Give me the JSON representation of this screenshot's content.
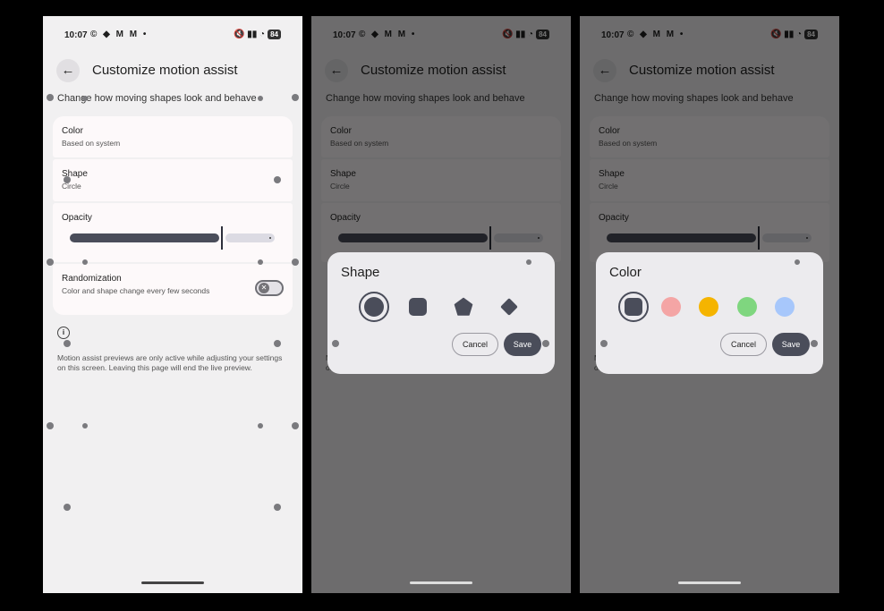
{
  "status": {
    "time": "10:07",
    "apps": "© ◆ M M •",
    "right": "🔇 ▮▮ ◔",
    "battery": "84"
  },
  "header": {
    "title": "Customize motion assist",
    "subtitle": "Change how moving shapes look and behave"
  },
  "settings": {
    "color": {
      "label": "Color",
      "value": "Based on system"
    },
    "shape": {
      "label": "Shape",
      "value": "Circle"
    },
    "opacity": {
      "label": "Opacity",
      "level_percent": 74
    },
    "randomization": {
      "label": "Randomization",
      "description": "Color and shape change every few seconds",
      "enabled": false
    }
  },
  "info_note": "Motion assist previews are only active while adjusting your settings on this screen. Leaving this page will end the live preview.",
  "shape_dialog": {
    "title": "Shape",
    "options": [
      "circle",
      "square",
      "pentagon",
      "diamond"
    ],
    "selected": "circle",
    "cancel": "Cancel",
    "save": "Save"
  },
  "color_dialog": {
    "title": "Color",
    "options": [
      "#4a4d5a",
      "#f4a5a5",
      "#f5b400",
      "#7fd67f",
      "#a7c7fb"
    ],
    "selected": "#4a4d5a",
    "cancel": "Cancel",
    "save": "Save"
  },
  "colors": {
    "accent": "#4a4d5a",
    "card": "#fdf9fa",
    "background": "#f1f0f1"
  }
}
